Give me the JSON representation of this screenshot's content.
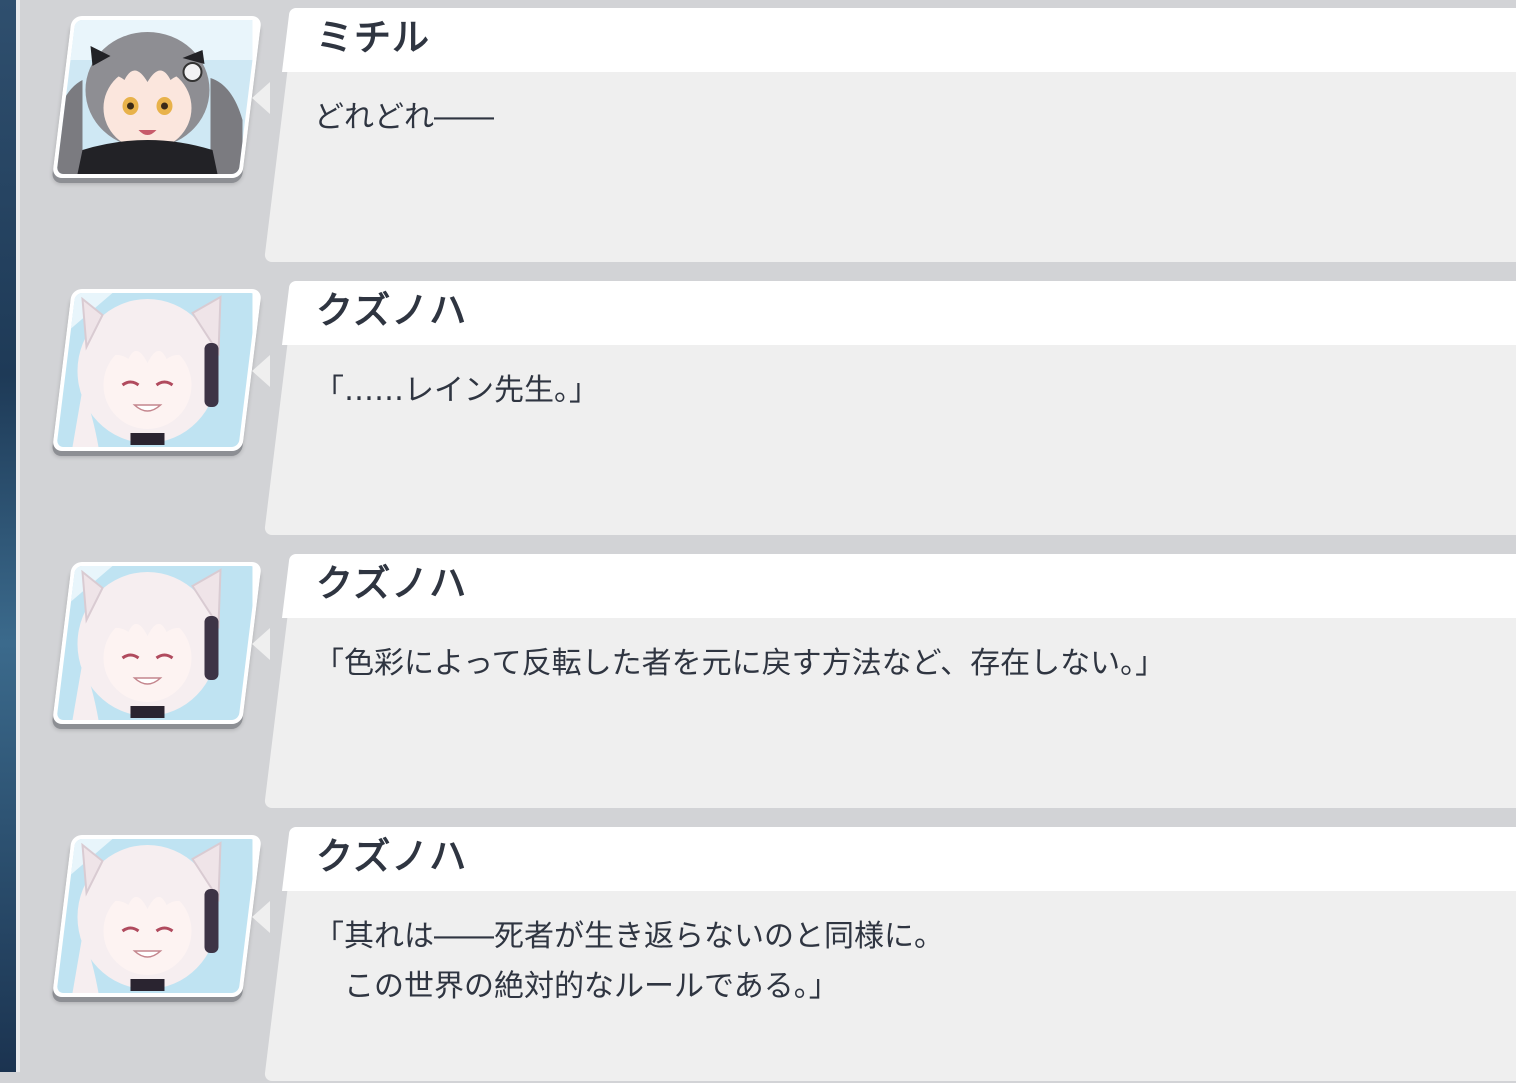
{
  "dialog_log": {
    "entries": [
      {
        "speaker": "ミチル",
        "portrait_icon": "michiru-portrait-icon",
        "lines": [
          "どれどれ――"
        ]
      },
      {
        "speaker": "クズノハ",
        "portrait_icon": "kuzunoha-portrait-icon",
        "lines": [
          "「……レイン先生。」"
        ]
      },
      {
        "speaker": "クズノハ",
        "portrait_icon": "kuzunoha-portrait-icon",
        "lines": [
          "「色彩によって反転した者を元に戻す方法など、存在しない。」"
        ]
      },
      {
        "speaker": "クズノハ",
        "portrait_icon": "kuzunoha-portrait-icon",
        "lines": [
          "「其れは――死者が生き返らないのと同様に。",
          "　この世界の絶対的なルールである。」"
        ]
      }
    ]
  },
  "colors": {
    "panel_background": "#d2d3d6",
    "name_bar": "#ffffff",
    "text_box": "#efefef",
    "text": "#2f3541"
  }
}
